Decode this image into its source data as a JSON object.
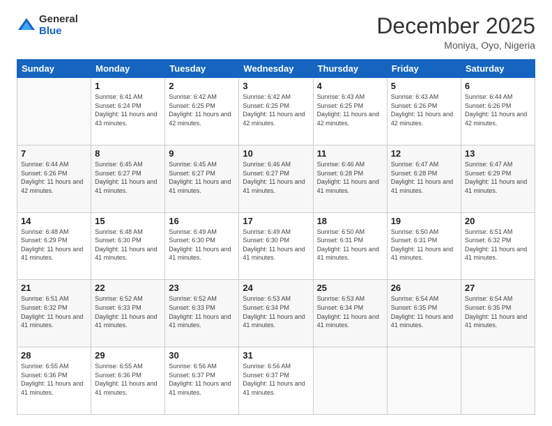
{
  "logo": {
    "general": "General",
    "blue": "Blue"
  },
  "header": {
    "month": "December 2025",
    "location": "Moniya, Oyo, Nigeria"
  },
  "days_of_week": [
    "Sunday",
    "Monday",
    "Tuesday",
    "Wednesday",
    "Thursday",
    "Friday",
    "Saturday"
  ],
  "weeks": [
    [
      {
        "num": "",
        "empty": true
      },
      {
        "num": "1",
        "sunrise": "6:41 AM",
        "sunset": "6:24 PM",
        "daylight": "11 hours and 43 minutes."
      },
      {
        "num": "2",
        "sunrise": "6:42 AM",
        "sunset": "6:25 PM",
        "daylight": "11 hours and 42 minutes."
      },
      {
        "num": "3",
        "sunrise": "6:42 AM",
        "sunset": "6:25 PM",
        "daylight": "11 hours and 42 minutes."
      },
      {
        "num": "4",
        "sunrise": "6:43 AM",
        "sunset": "6:25 PM",
        "daylight": "11 hours and 42 minutes."
      },
      {
        "num": "5",
        "sunrise": "6:43 AM",
        "sunset": "6:26 PM",
        "daylight": "11 hours and 42 minutes."
      },
      {
        "num": "6",
        "sunrise": "6:44 AM",
        "sunset": "6:26 PM",
        "daylight": "11 hours and 42 minutes."
      }
    ],
    [
      {
        "num": "7",
        "sunrise": "6:44 AM",
        "sunset": "6:26 PM",
        "daylight": "11 hours and 42 minutes."
      },
      {
        "num": "8",
        "sunrise": "6:45 AM",
        "sunset": "6:27 PM",
        "daylight": "11 hours and 41 minutes."
      },
      {
        "num": "9",
        "sunrise": "6:45 AM",
        "sunset": "6:27 PM",
        "daylight": "11 hours and 41 minutes."
      },
      {
        "num": "10",
        "sunrise": "6:46 AM",
        "sunset": "6:27 PM",
        "daylight": "11 hours and 41 minutes."
      },
      {
        "num": "11",
        "sunrise": "6:46 AM",
        "sunset": "6:28 PM",
        "daylight": "11 hours and 41 minutes."
      },
      {
        "num": "12",
        "sunrise": "6:47 AM",
        "sunset": "6:28 PM",
        "daylight": "11 hours and 41 minutes."
      },
      {
        "num": "13",
        "sunrise": "6:47 AM",
        "sunset": "6:29 PM",
        "daylight": "11 hours and 41 minutes."
      }
    ],
    [
      {
        "num": "14",
        "sunrise": "6:48 AM",
        "sunset": "6:29 PM",
        "daylight": "11 hours and 41 minutes."
      },
      {
        "num": "15",
        "sunrise": "6:48 AM",
        "sunset": "6:30 PM",
        "daylight": "11 hours and 41 minutes."
      },
      {
        "num": "16",
        "sunrise": "6:49 AM",
        "sunset": "6:30 PM",
        "daylight": "11 hours and 41 minutes."
      },
      {
        "num": "17",
        "sunrise": "6:49 AM",
        "sunset": "6:30 PM",
        "daylight": "11 hours and 41 minutes."
      },
      {
        "num": "18",
        "sunrise": "6:50 AM",
        "sunset": "6:31 PM",
        "daylight": "11 hours and 41 minutes."
      },
      {
        "num": "19",
        "sunrise": "6:50 AM",
        "sunset": "6:31 PM",
        "daylight": "11 hours and 41 minutes."
      },
      {
        "num": "20",
        "sunrise": "6:51 AM",
        "sunset": "6:32 PM",
        "daylight": "11 hours and 41 minutes."
      }
    ],
    [
      {
        "num": "21",
        "sunrise": "6:51 AM",
        "sunset": "6:32 PM",
        "daylight": "11 hours and 41 minutes."
      },
      {
        "num": "22",
        "sunrise": "6:52 AM",
        "sunset": "6:33 PM",
        "daylight": "11 hours and 41 minutes."
      },
      {
        "num": "23",
        "sunrise": "6:52 AM",
        "sunset": "6:33 PM",
        "daylight": "11 hours and 41 minutes."
      },
      {
        "num": "24",
        "sunrise": "6:53 AM",
        "sunset": "6:34 PM",
        "daylight": "11 hours and 41 minutes."
      },
      {
        "num": "25",
        "sunrise": "6:53 AM",
        "sunset": "6:34 PM",
        "daylight": "11 hours and 41 minutes."
      },
      {
        "num": "26",
        "sunrise": "6:54 AM",
        "sunset": "6:35 PM",
        "daylight": "11 hours and 41 minutes."
      },
      {
        "num": "27",
        "sunrise": "6:54 AM",
        "sunset": "6:35 PM",
        "daylight": "11 hours and 41 minutes."
      }
    ],
    [
      {
        "num": "28",
        "sunrise": "6:55 AM",
        "sunset": "6:36 PM",
        "daylight": "11 hours and 41 minutes."
      },
      {
        "num": "29",
        "sunrise": "6:55 AM",
        "sunset": "6:36 PM",
        "daylight": "11 hours and 41 minutes."
      },
      {
        "num": "30",
        "sunrise": "6:56 AM",
        "sunset": "6:37 PM",
        "daylight": "11 hours and 41 minutes."
      },
      {
        "num": "31",
        "sunrise": "6:56 AM",
        "sunset": "6:37 PM",
        "daylight": "11 hours and 41 minutes."
      },
      {
        "num": "",
        "empty": true
      },
      {
        "num": "",
        "empty": true
      },
      {
        "num": "",
        "empty": true
      }
    ]
  ],
  "labels": {
    "sunrise": "Sunrise:",
    "sunset": "Sunset:",
    "daylight": "Daylight:"
  }
}
